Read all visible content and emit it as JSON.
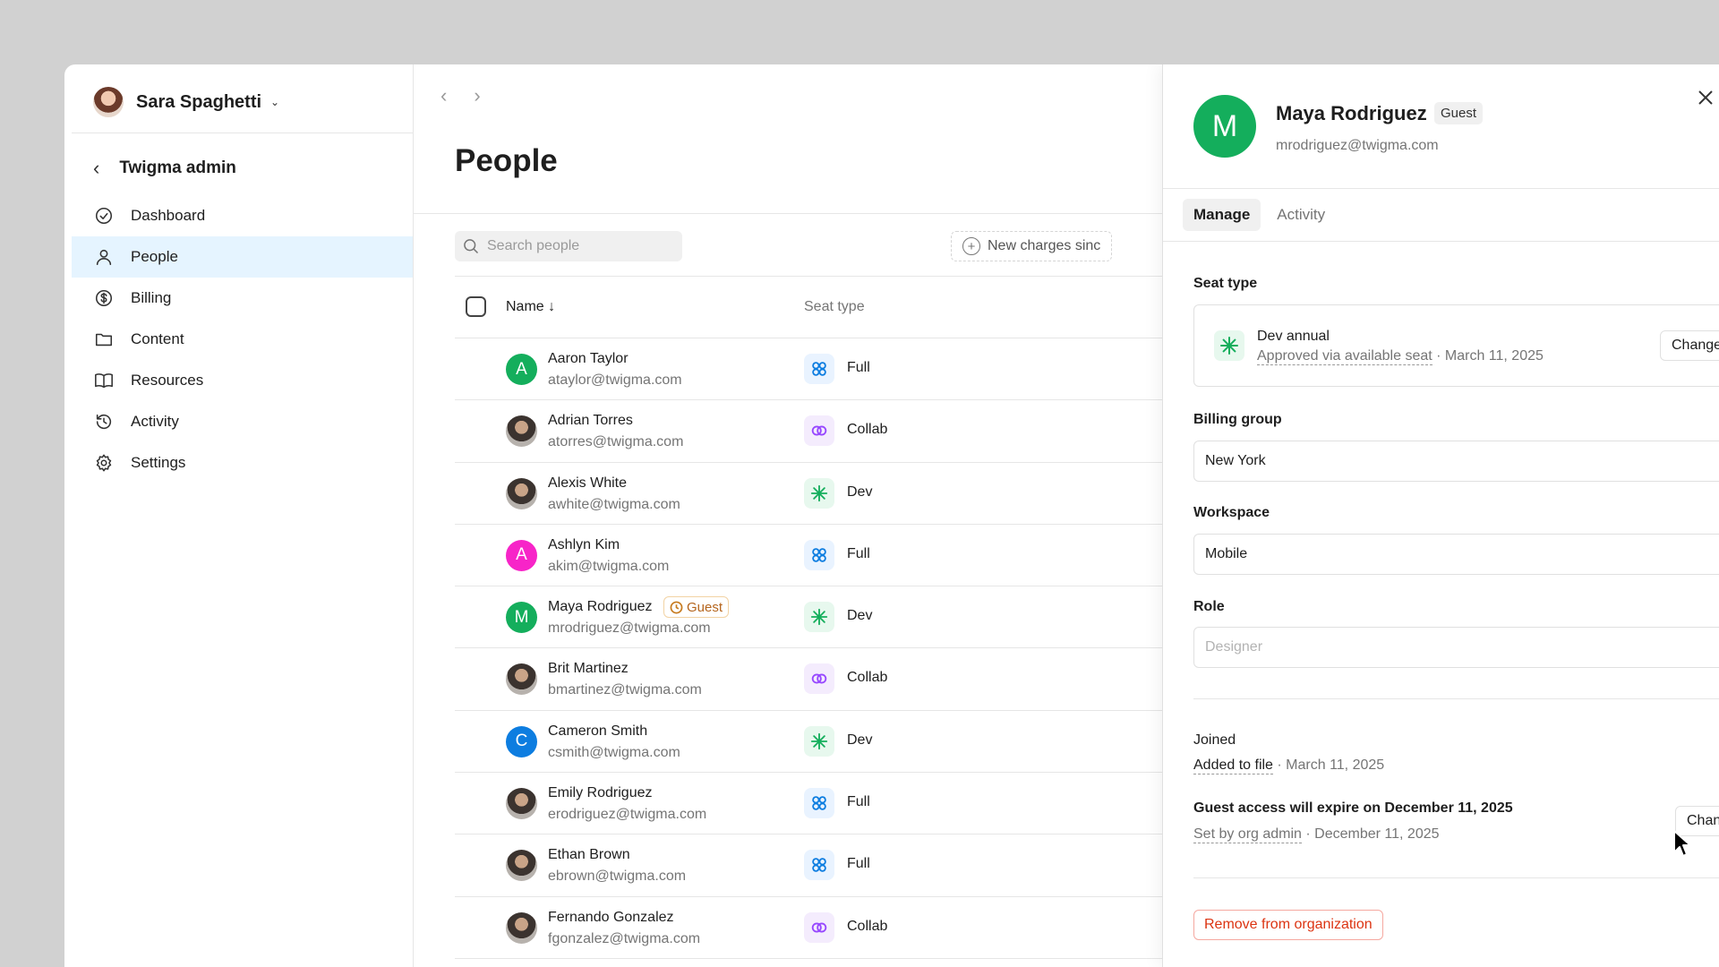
{
  "sidebar": {
    "user_name": "Sara Spaghetti",
    "admin_title": "Twigma admin",
    "items": [
      {
        "label": "Dashboard",
        "icon": "dashboard-icon",
        "active": false
      },
      {
        "label": "People",
        "icon": "person-icon",
        "active": true
      },
      {
        "label": "Billing",
        "icon": "billing-icon",
        "active": false
      },
      {
        "label": "Content",
        "icon": "folder-icon",
        "active": false
      },
      {
        "label": "Resources",
        "icon": "book-icon",
        "active": false
      },
      {
        "label": "Activity",
        "icon": "history-icon",
        "active": false
      },
      {
        "label": "Settings",
        "icon": "gear-icon",
        "active": false
      }
    ]
  },
  "main": {
    "title": "People",
    "search_placeholder": "Search people",
    "new_charges_label": "New charges sinc",
    "columns": {
      "name": "Name",
      "sort_arrow": "↓",
      "seat": "Seat type"
    },
    "people": [
      {
        "name": "Aaron Taylor",
        "email": "ataylor@twigma.com",
        "initial": "A",
        "avatar_color": "#14ae5c",
        "seat": "Full",
        "guest": ""
      },
      {
        "name": "Adrian Torres",
        "email": "atorres@twigma.com",
        "initial": "",
        "avatar_color": "",
        "seat": "Collab",
        "guest": ""
      },
      {
        "name": "Alexis White",
        "email": "awhite@twigma.com",
        "initial": "",
        "avatar_color": "",
        "seat": "Dev",
        "guest": ""
      },
      {
        "name": "Ashlyn Kim",
        "email": "akim@twigma.com",
        "initial": "A",
        "avatar_color": "#f724c8",
        "seat": "Full",
        "guest": ""
      },
      {
        "name": "Maya Rodriguez",
        "email": "mrodriguez@twigma.com",
        "initial": "M",
        "avatar_color": "#14ae5c",
        "seat": "Dev",
        "guest": "Guest"
      },
      {
        "name": "Brit Martinez",
        "email": "bmartinez@twigma.com",
        "initial": "",
        "avatar_color": "",
        "seat": "Collab",
        "guest": ""
      },
      {
        "name": "Cameron Smith",
        "email": "csmith@twigma.com",
        "initial": "C",
        "avatar_color": "#0d7de0",
        "seat": "Dev",
        "guest": ""
      },
      {
        "name": "Emily Rodriguez",
        "email": "erodriguez@twigma.com",
        "initial": "",
        "avatar_color": "",
        "seat": "Full",
        "guest": ""
      },
      {
        "name": "Ethan Brown",
        "email": "ebrown@twigma.com",
        "initial": "",
        "avatar_color": "",
        "seat": "Full",
        "guest": ""
      },
      {
        "name": "Fernando Gonzalez",
        "email": "fgonzalez@twigma.com",
        "initial": "",
        "avatar_color": "",
        "seat": "Collab",
        "guest": ""
      }
    ]
  },
  "panel": {
    "initial": "M",
    "name": "Maya Rodriguez",
    "badge": "Guest",
    "email": "mrodriguez@twigma.com",
    "tabs": [
      "Manage",
      "Activity"
    ],
    "seat_type_label": "Seat type",
    "seat_title": "Dev annual",
    "seat_approval": "Approved via available seat",
    "seat_date": " · March 11, 2025",
    "change_label": "Change",
    "billing_group_label": "Billing group",
    "billing_group_value": "New York",
    "workspace_label": "Workspace",
    "workspace_value": "Mobile",
    "role_label": "Role",
    "role_placeholder": "Designer",
    "joined_label": "Joined",
    "joined_via": "Added to file",
    "joined_date": " · March 11, 2025",
    "expire_label": "Guest access will expire on December 11, 2025",
    "expire_set_by": "Set by org admin",
    "expire_date": " · December 11, 2025",
    "expire_change_label": "Change",
    "remove_label": "Remove from organization"
  }
}
